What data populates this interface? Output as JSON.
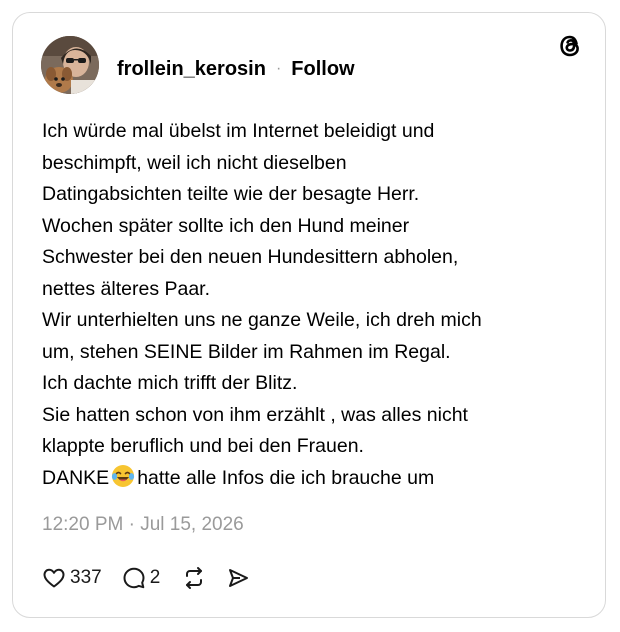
{
  "post": {
    "author": {
      "username": "frollein_kerosin",
      "separator": "·",
      "follow_label": "Follow"
    },
    "text_lines": [
      "Ich würde mal übelst im Internet beleidigt und",
      "beschimpft, weil ich nicht dieselben",
      "Datingabsichten teilte wie der besagte Herr.",
      "Wochen später sollte ich den Hund meiner",
      "Schwester bei den neuen Hundesittern abholen,",
      "nettes älteres Paar.",
      "Wir unterhielten uns ne ganze Weile, ich dreh mich",
      "um, stehen SEINE Bilder im Rahmen im Regal.",
      "Ich dachte mich trifft der Blitz.",
      "Sie hatten schon von ihm erzählt , was alles nicht",
      "klappte beruflich und bei den Frauen."
    ],
    "last_line": {
      "before_emoji": "DANKE",
      "emoji": "face-with-tears-of-joy",
      "after_emoji": "hatte alle Infos die ich brauche um"
    },
    "timestamp": "12:20 PM · Jul 15, 2026",
    "stats": {
      "likes": "337",
      "replies": "2"
    }
  },
  "icons": {
    "brand": "threads-logo",
    "like": "heart-icon",
    "reply": "comment-bubble-icon",
    "repost": "repost-icon",
    "share": "send-icon"
  },
  "colors": {
    "text": "#000000",
    "muted": "#9a9a9a",
    "border": "#d9d9d9",
    "emoji_face": "#f7c531"
  }
}
